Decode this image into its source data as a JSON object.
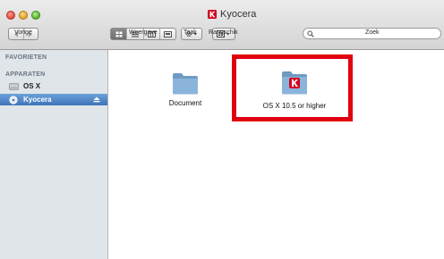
{
  "window": {
    "title": "Kyocera",
    "title_icon": "kyocera-logo-icon"
  },
  "toolbar": {
    "back_label": "Vorige",
    "view_label": "Weergave",
    "action_label": "Taak",
    "arrange_label": "Rangschik",
    "search_label": "Zoek",
    "search_placeholder": ""
  },
  "sidebar": {
    "sections": [
      {
        "header": "FAVORIETEN"
      },
      {
        "header": "APPARATEN"
      }
    ],
    "items": [
      {
        "label": "OS X",
        "icon": "hard-drive-icon",
        "selected": false
      },
      {
        "label": "Kyocera",
        "icon": "disc-icon",
        "selected": true,
        "eject_icon": "eject-icon"
      }
    ]
  },
  "content": {
    "files": [
      {
        "label": "Document",
        "icon": "folder-icon"
      },
      {
        "label": "OS X 10.5 or higher",
        "icon": "kyocera-folder-icon",
        "highlighted": true
      }
    ]
  },
  "colors": {
    "highlight": "#e1000f",
    "sidebar_bg": "#e0e5ea",
    "selection": "#3d73b8",
    "brand_red": "#d4001f"
  }
}
